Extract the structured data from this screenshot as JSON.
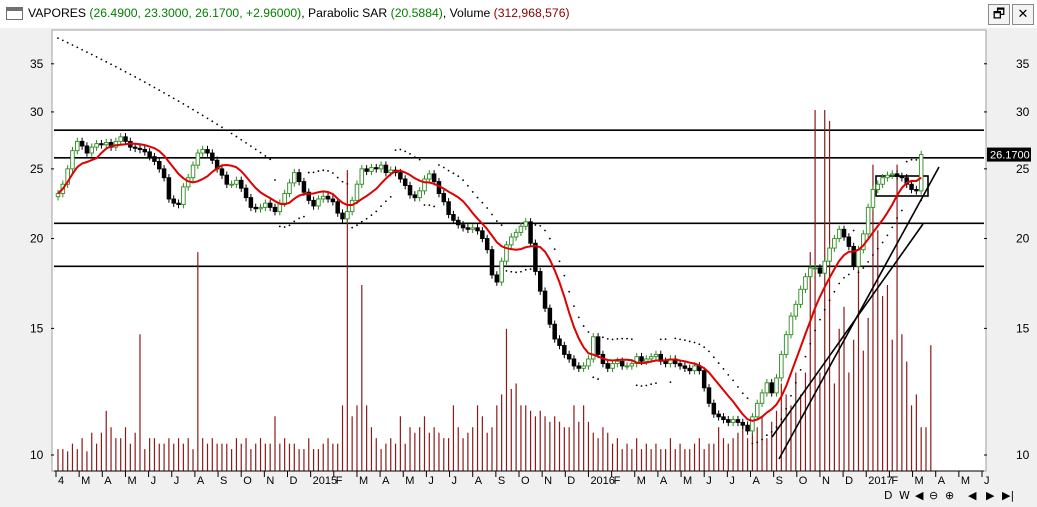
{
  "window": {
    "title_symbol": "VAPORES",
    "title_values": "(26.4900, 23.3000, 26.1700, +2.96000)",
    "title_sar_label": "Parabolic SAR",
    "title_sar_value": "(20.5884)",
    "title_volume_label": "Volume",
    "title_volume_value": "(312,968,576)",
    "restore_glyph": "🗗",
    "close_glyph": "✕"
  },
  "nav": {
    "day": "D",
    "week": "W",
    "prev": "◀",
    "zoom_out": "⊖",
    "zoom_in": "⊕",
    "back": "◀",
    "forward": "▶",
    "end": "▶|"
  },
  "colors": {
    "up_candle": "#2e8b22",
    "down_candle": "#000000",
    "moving_average": "#e00000",
    "sar_dots": "#000000",
    "volume": "#8b1a1a",
    "support_lines": "#000000",
    "last_price_bg": "#000000"
  },
  "chart_data": {
    "type": "candlestick",
    "y_scale": "log",
    "ylim": [
      9.5,
      39
    ],
    "y_ticks": [
      "10",
      "15",
      "20",
      "25",
      "30",
      "35"
    ],
    "x_ticks": [
      "4",
      "M",
      "A",
      "M",
      "J",
      "J",
      "A",
      "S",
      "O",
      "N",
      "D",
      "2015",
      "F",
      "M",
      "A",
      "M",
      "J",
      "J",
      "A",
      "S",
      "O",
      "N",
      "D",
      "2016",
      "F",
      "M",
      "A",
      "M",
      "J",
      "J",
      "A",
      "S",
      "O",
      "N",
      "D",
      "2017",
      "F",
      "M",
      "A",
      "M",
      "J"
    ],
    "last_price_label": "26.1700",
    "last_price": 26.17,
    "horizontal_levels": [
      28.3,
      25.9,
      21.0,
      18.3
    ],
    "close": [
      23.1,
      23.8,
      25.0,
      26.5,
      27.3,
      26.9,
      26.3,
      26.8,
      27.1,
      27.0,
      27.2,
      26.8,
      27.3,
      27.7,
      27.3,
      26.8,
      26.7,
      26.6,
      26.4,
      26.0,
      25.6,
      25.0,
      24.3,
      22.7,
      22.4,
      22.3,
      23.6,
      24.3,
      25.3,
      26.3,
      26.6,
      26.3,
      25.7,
      25.0,
      24.5,
      23.8,
      23.8,
      24.1,
      23.5,
      22.8,
      22.1,
      22.0,
      22.1,
      22.4,
      22.1,
      21.8,
      22.4,
      23.1,
      23.9,
      24.7,
      24.0,
      23.2,
      22.6,
      22.2,
      22.7,
      22.9,
      22.7,
      22.5,
      21.7,
      21.3,
      21.8,
      22.6,
      23.8,
      25.0,
      24.8,
      25.1,
      25.0,
      25.3,
      24.7,
      24.9,
      24.7,
      24.2,
      23.7,
      23.0,
      22.8,
      23.3,
      24.2,
      24.6,
      24.0,
      23.1,
      22.5,
      21.6,
      21.2,
      20.9,
      20.7,
      20.6,
      20.7,
      20.5,
      20.0,
      19.3,
      17.8,
      17.4,
      18.6,
      19.6,
      20.1,
      20.4,
      20.8,
      21.1,
      19.7,
      18.0,
      16.9,
      16.0,
      15.2,
      14.5,
      14.2,
      13.8,
      13.6,
      13.3,
      13.2,
      13.3,
      13.6,
      14.6,
      13.8,
      13.4,
      13.2,
      13.4,
      13.5,
      13.3,
      13.3,
      13.4,
      13.7,
      13.5,
      13.6,
      13.7,
      13.8,
      13.5,
      13.4,
      13.6,
      13.4,
      13.3,
      13.2,
      13.1,
      13.3,
      13.1,
      12.4,
      11.8,
      11.4,
      11.3,
      11.2,
      11.1,
      11.2,
      11.1,
      11.0,
      10.8,
      11.3,
      11.8,
      12.2,
      12.6,
      12.2,
      12.8,
      13.8,
      14.7,
      15.6,
      16.2,
      17.0,
      17.7,
      18.2,
      18.2,
      17.9,
      18.6,
      19.4,
      20.0,
      20.6,
      20.1,
      19.5,
      18.3,
      19.3,
      20.3,
      22.1,
      23.4,
      23.8,
      24.3,
      24.5,
      24.6,
      24.4,
      24.3,
      23.8,
      23.4,
      23.3,
      26.17
    ],
    "moving_average_start_index": 0,
    "volume_millions": [
      20,
      20,
      18,
      25,
      20,
      30,
      18,
      35,
      25,
      35,
      55,
      40,
      30,
      30,
      40,
      25,
      35,
      125,
      20,
      30,
      30,
      25,
      25,
      30,
      25,
      30,
      25,
      30,
      20,
      200,
      30,
      25,
      30,
      25,
      25,
      25,
      20,
      30,
      25,
      30,
      20,
      25,
      30,
      25,
      25,
      50,
      25,
      30,
      25,
      25,
      20,
      20,
      30,
      20,
      20,
      25,
      30,
      25,
      25,
      60,
      275,
      50,
      60,
      170,
      60,
      40,
      30,
      20,
      25,
      30,
      25,
      50,
      25,
      40,
      35,
      40,
      50,
      35,
      40,
      35,
      30,
      30,
      60,
      40,
      30,
      35,
      40,
      60,
      50,
      35,
      40,
      60,
      70,
      130,
      75,
      80,
      60,
      60,
      55,
      50,
      55,
      50,
      45,
      50,
      45,
      40,
      40,
      60,
      45,
      60,
      45,
      35,
      30,
      40,
      35,
      25,
      30,
      20,
      25,
      20,
      30,
      20,
      25,
      20,
      25,
      20,
      20,
      30,
      20,
      25,
      20,
      20,
      25,
      30,
      20,
      25,
      25,
      40,
      30,
      25,
      30,
      35,
      45,
      30,
      35,
      40,
      50,
      30,
      45,
      55,
      80,
      70,
      60,
      90,
      70,
      90,
      200,
      330,
      90,
      330,
      320,
      80,
      130,
      150,
      90,
      120,
      200,
      110,
      140,
      280,
      220,
      160,
      170,
      120,
      280,
      125,
      100,
      60,
      70,
      40,
      40,
      115
    ]
  }
}
